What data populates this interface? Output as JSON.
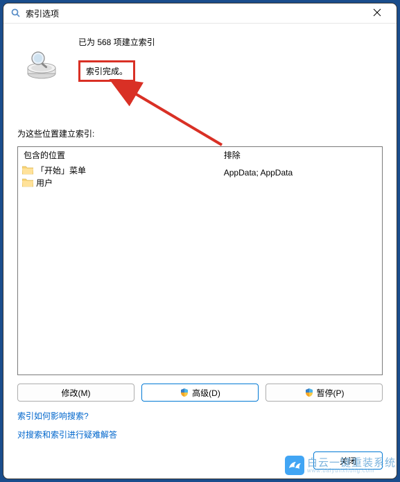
{
  "titlebar": {
    "title": "索引选项"
  },
  "status": {
    "line1": "已为 568 项建立索引",
    "line2": "索引完成。"
  },
  "section_label": "为这些位置建立索引:",
  "locations": {
    "header_include": "包含的位置",
    "header_exclude": "排除",
    "items": [
      {
        "name": "「开始」菜单",
        "exclude": ""
      },
      {
        "name": "用户",
        "exclude": "AppData; AppData"
      }
    ]
  },
  "buttons": {
    "modify": "修改(M)",
    "advanced": "高级(D)",
    "pause": "暂停(P)"
  },
  "links": {
    "how_affects": "索引如何影响搜索?",
    "troubleshoot": "对搜索和索引进行疑难解答"
  },
  "footer": {
    "close": "关闭"
  },
  "watermark": {
    "text": "白云一键重装系统",
    "url": "www.baiyunxitong.com"
  }
}
